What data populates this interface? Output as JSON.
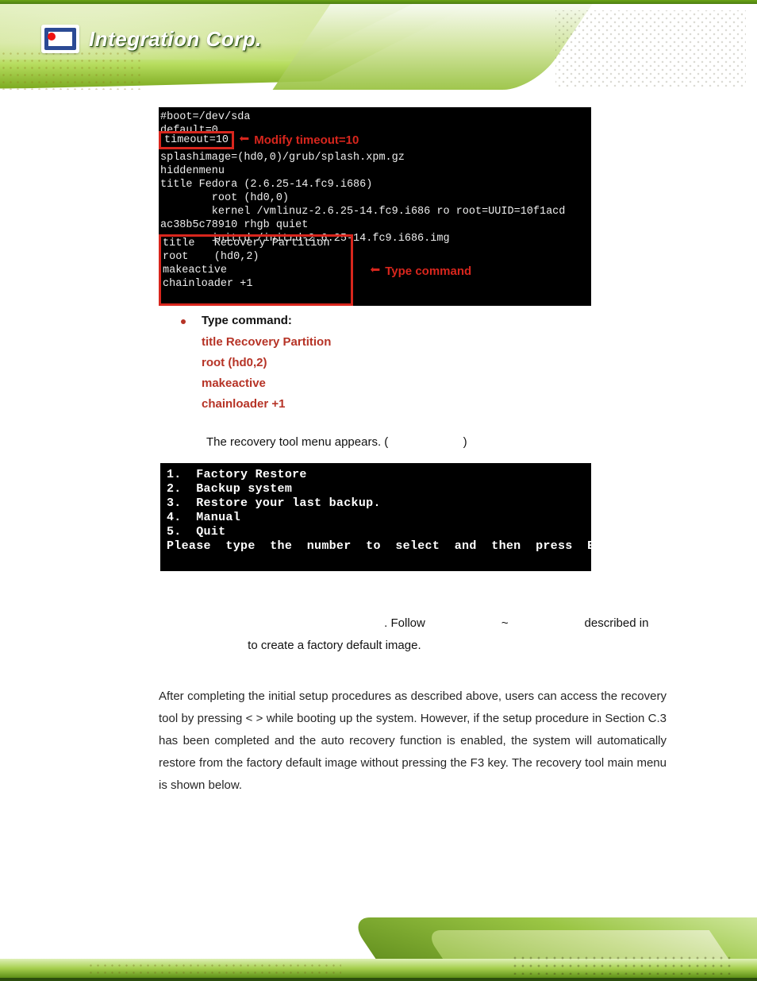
{
  "brand": {
    "name": "Integration Corp."
  },
  "term1": {
    "l1": "#boot=/dev/sda",
    "l2": "default=0",
    "l3": "timeout=10",
    "note_top": "Modify timeout=10",
    "l4": "splashimage=(hd0,0)/grub/splash.xpm.gz",
    "l5": "hiddenmenu",
    "l6": "title Fedora (2.6.25-14.fc9.i686)",
    "l7": "        root (hd0,0)",
    "l8": "        kernel /vmlinuz-2.6.25-14.fc9.i686 ro root=UUID=10f1acd",
    "l9": "ac38b5c78910 rhgb quiet",
    "l10": "        initrd /initrd-2.6.25-14.fc9.i686.img",
    "b1": "title   Recovery Partition",
    "b2": "root    (hd0,2)",
    "b3": "makeactive",
    "b4": "chainloader +1",
    "note_bot": "Type command"
  },
  "bullet": {
    "label": "Type command:"
  },
  "redlist": {
    "l1": "title Recovery Partition",
    "l2": "root (hd0,2)",
    "l3": "makeactive",
    "l4": "chainloader +1"
  },
  "step": {
    "text_a": "The recovery tool menu appears. (",
    "text_b": ")"
  },
  "menu": {
    "l1": "1.  Factory Restore",
    "l2": "2.  Backup system",
    "l3": "3.  Restore your last backup.",
    "l4": "4.  Manual",
    "l5": "5.  Quit",
    "l6": "Please  type  the  number  to  select  and  then  press  Enter:"
  },
  "follow": {
    "a": ". Follow",
    "b": "~",
    "c": "described in",
    "d": "to create a factory default image."
  },
  "body": {
    "text": "After completing the initial setup procedures as described above, users can access the recovery tool by pressing <   > while booting up the system. However, if the setup procedure in Section C.3 has been completed and the auto recovery function is enabled, the system will automatically restore from the factory default image without pressing the F3 key. The recovery tool main menu is shown below."
  }
}
